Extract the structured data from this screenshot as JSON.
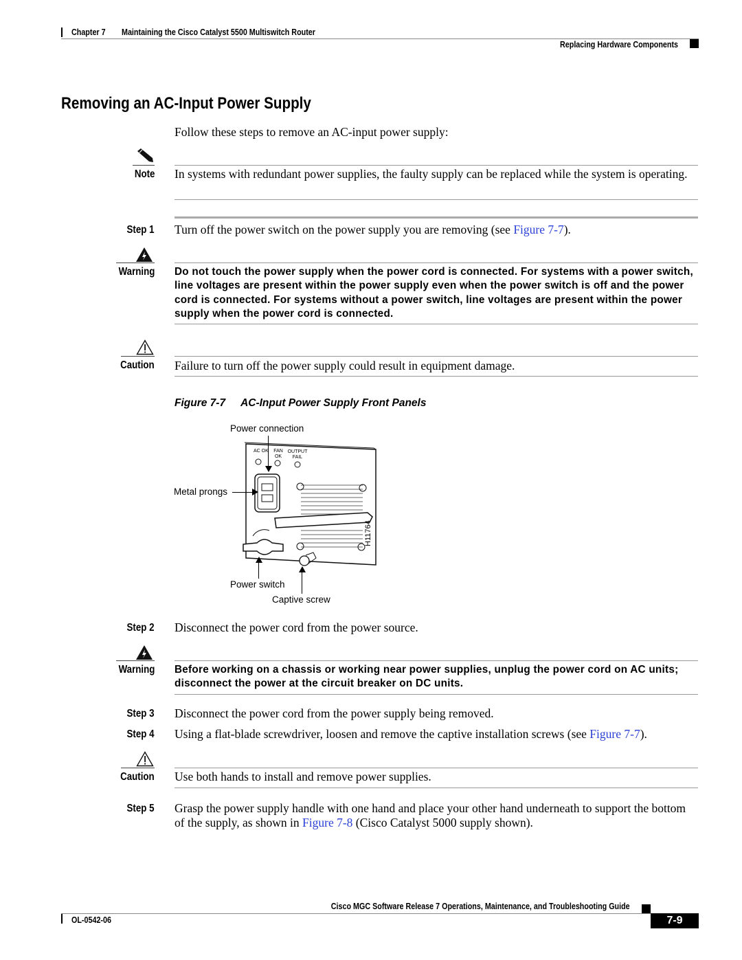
{
  "header": {
    "chapter": "Chapter 7",
    "chapter_title": "Maintaining the Cisco Catalyst 5500 Multiswitch Router",
    "section": "Replacing Hardware Components"
  },
  "title": "Removing an AC-Input Power Supply",
  "intro": "Follow these steps to remove an AC-input power supply:",
  "note": {
    "label": "Note",
    "text": "In systems with redundant power supplies, the faulty supply can be replaced while the system is operating."
  },
  "step1": {
    "label": "Step 1",
    "text": "Turn off the power switch on the power supply you are removing (see ",
    "link": "Figure 7-7",
    "after": ")."
  },
  "warning1": {
    "label": "Warning",
    "text": "Do not touch the power supply when the power cord is connected. For systems with a power switch, line voltages are present within the power supply even when the power switch is off and the power cord is connected. For systems without a power switch, line voltages are present within the power supply when the power cord is connected."
  },
  "caution1": {
    "label": "Caution",
    "text": "Failure to turn off the power supply could result in equipment damage."
  },
  "figure": {
    "number": "Figure 7-7",
    "title": "AC-Input Power Supply Front Panels",
    "labels": {
      "power_connection": "Power connection",
      "metal_prongs": "Metal prongs",
      "power_switch": "Power switch",
      "captive_screw": "Captive screw",
      "ac_ok": "AC OK",
      "fan_ok": "FAN OK",
      "output_fail": "OUTPUT FAIL",
      "id": "H11764"
    }
  },
  "step2": {
    "label": "Step 2",
    "text": "Disconnect the power cord from the power source."
  },
  "warning2": {
    "label": "Warning",
    "text": "Before working on a chassis or working near power supplies, unplug the power cord on AC units; disconnect the power at the circuit breaker on DC units."
  },
  "step3": {
    "label": "Step 3",
    "text": "Disconnect the power cord from the power supply being removed."
  },
  "step4": {
    "label": "Step 4",
    "text": "Using a flat-blade screwdriver, loosen and remove the captive installation screws (see ",
    "link": "Figure 7-7",
    "after": ")."
  },
  "caution2": {
    "label": "Caution",
    "text": "Use both hands to install and remove power supplies."
  },
  "step5": {
    "label": "Step 5",
    "text": "Grasp the power supply handle with one hand and place your other hand underneath to support the bottom of the supply, as shown in ",
    "link": "Figure 7-8",
    "after": " (Cisco Catalyst 5000 supply shown)."
  },
  "footer": {
    "guide": "Cisco MGC Software Release 7 Operations, Maintenance, and Troubleshooting Guide",
    "doc_id": "OL-0542-06",
    "page": "7-9"
  }
}
